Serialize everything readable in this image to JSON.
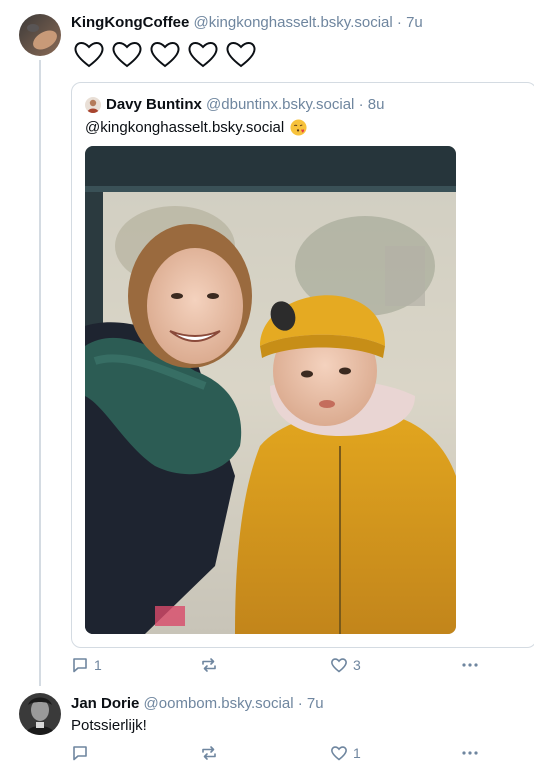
{
  "post1": {
    "name": "KingKongCoffee",
    "handle": "@kingkonghasselt.bsky.social",
    "separator": "·",
    "time": "7u",
    "hearts": [
      "heart-outline",
      "heart-outline",
      "heart-outline",
      "heart-outline",
      "heart-outline"
    ],
    "quote": {
      "name": "Davy Buntinx",
      "handle": "@dbuntinx.bsky.social",
      "separator": "·",
      "time": "8u",
      "text": "@kingkonghasselt.bsky.social",
      "emoji": "face-blowing-kiss-emoji"
    },
    "actions": {
      "reply_count": "1",
      "repost_count": "",
      "like_count": "3"
    }
  },
  "post2": {
    "name": "Jan Dorie",
    "handle": "@oombom.bsky.social",
    "separator": "·",
    "time": "7u",
    "text": "Potssierlijk!",
    "actions": {
      "reply_count": "",
      "repost_count": "",
      "like_count": "1"
    }
  },
  "colors": {
    "muted": "#6f869f",
    "border": "#d4dbe2",
    "text": "#0b0f14"
  }
}
